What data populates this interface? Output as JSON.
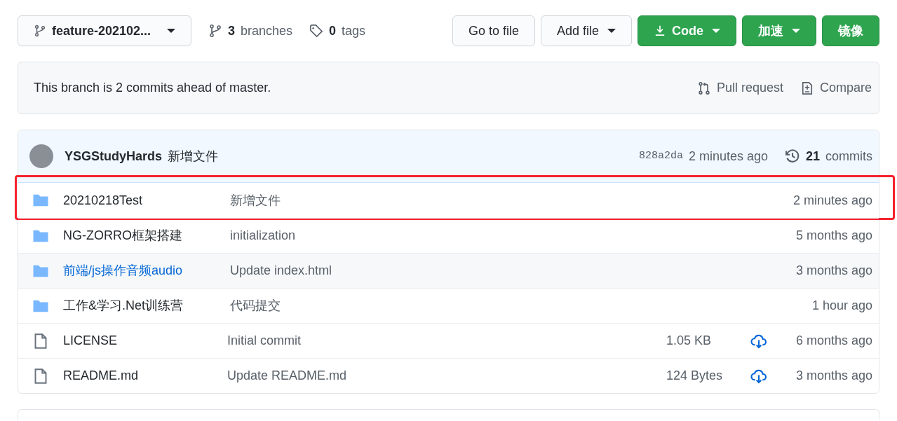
{
  "branch_select": {
    "label": "feature-202102..."
  },
  "branches": {
    "count": "3",
    "label": "branches"
  },
  "tags": {
    "count": "0",
    "label": "tags"
  },
  "buttons": [
    {
      "label": "Go to file",
      "kind": "plain",
      "caret": false,
      "icon": false
    },
    {
      "label": "Add file",
      "kind": "plain",
      "caret": true,
      "icon": false
    },
    {
      "label": "Code",
      "kind": "green",
      "caret": true,
      "icon": true
    },
    {
      "label": "加速",
      "kind": "green",
      "caret": true,
      "icon": false
    },
    {
      "label": "镜像",
      "kind": "green",
      "caret": false,
      "icon": false
    }
  ],
  "banner": {
    "text": "This branch is 2 commits ahead of master.",
    "pull_request": "Pull request",
    "compare": "Compare"
  },
  "latest_commit": {
    "author": "YSGStudyHards",
    "message": "新增文件",
    "sha": "828a2da",
    "time": "2 minutes ago",
    "commits_count": "21",
    "commits_label": "commits"
  },
  "files": [
    {
      "kind": "folder",
      "name": "20210218Test",
      "message": "新增文件",
      "time": "2 minutes ago",
      "highlighted": true,
      "hovered": false
    },
    {
      "kind": "folder",
      "name": "NG-ZORRO框架搭建",
      "message": "initialization",
      "time": "5 months ago",
      "highlighted": false,
      "hovered": false
    },
    {
      "kind": "folder",
      "name": "前端/js操作音频audio",
      "message": "Update index.html",
      "time": "3 months ago",
      "highlighted": false,
      "hovered": true
    },
    {
      "kind": "folder",
      "name": "工作&学习.Net训练营",
      "message": "代码提交",
      "time": "1 hour ago",
      "highlighted": false,
      "hovered": false
    },
    {
      "kind": "file",
      "name": "LICENSE",
      "message": "Initial commit",
      "size": "1.05 KB",
      "time": "6 months ago",
      "highlighted": false,
      "hovered": false
    },
    {
      "kind": "file",
      "name": "README.md",
      "message": "Update README.md",
      "size": "124 Bytes",
      "time": "3 months ago",
      "highlighted": false,
      "hovered": false
    }
  ]
}
